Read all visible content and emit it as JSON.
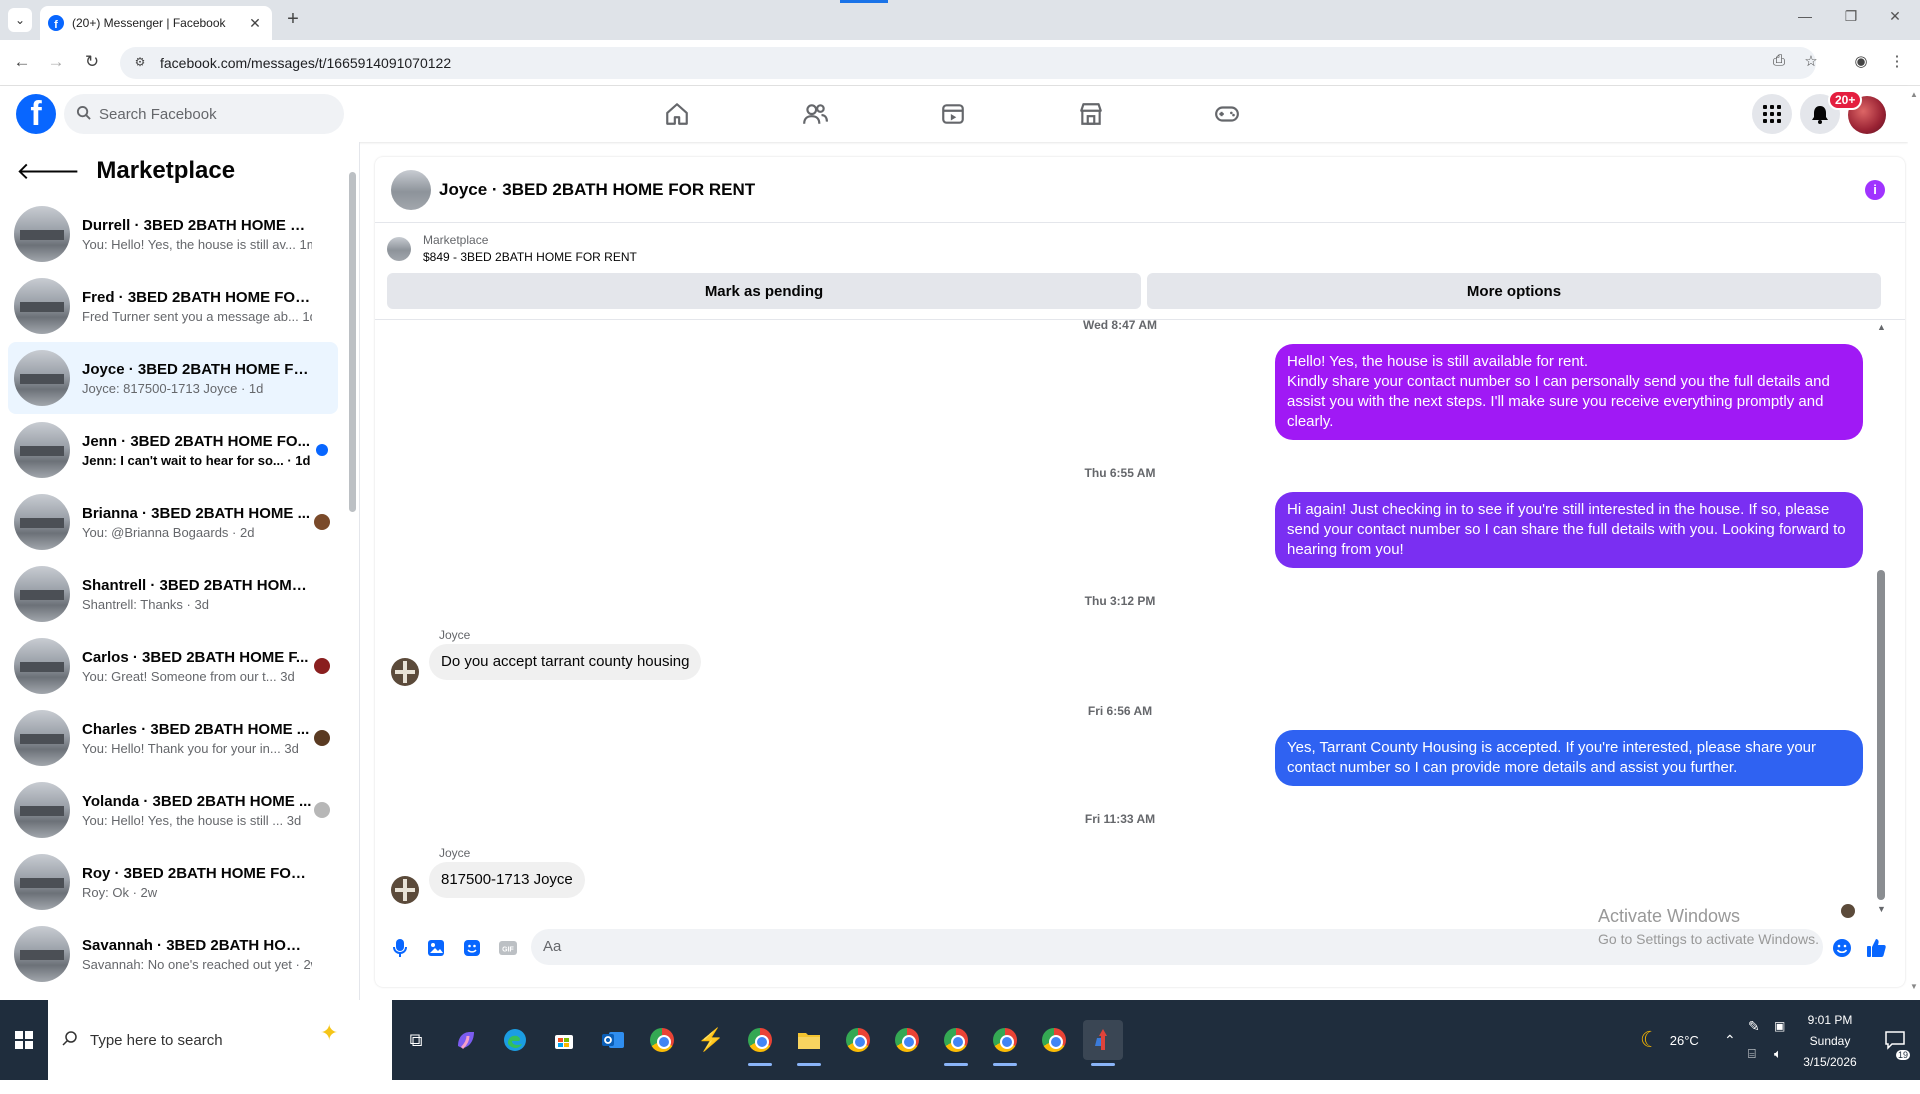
{
  "browser": {
    "tab_title": "(20+) Messenger | Facebook",
    "url": "facebook.com/messages/t/1665914091070122",
    "favicon_letter": "f"
  },
  "fb": {
    "search_placeholder": "Search Facebook",
    "logo_letter": "f",
    "notification_badge": "20+"
  },
  "sidebar": {
    "title": "Marketplace",
    "conversations": [
      {
        "name": "Durrell · 3BED 2BATH HOME FO...",
        "preview": "You: Hello! Yes, the house is still av... 1m",
        "unread": false
      },
      {
        "name": "Fred · 3BED 2BATH HOME FOR ...",
        "preview": "Fred Turner sent you a message ab... 1d",
        "unread": false
      },
      {
        "name": "Joyce · 3BED 2BATH HOME FOR ...",
        "preview": "Joyce: 817500-1713 Joyce · 1d",
        "unread": false,
        "active": true
      },
      {
        "name": "Jenn · 3BED 2BATH HOME FO...",
        "preview": "Jenn: I can't wait to hear for so... · 1d",
        "unread": true
      },
      {
        "name": "Brianna · 3BED 2BATH HOME ...",
        "preview": "You: @Brianna Bogaards · 2d",
        "unread": false
      },
      {
        "name": "Shantrell · 3BED 2BATH HOME F...",
        "preview": "Shantrell: Thanks · 3d",
        "unread": false
      },
      {
        "name": "Carlos · 3BED 2BATH HOME F...",
        "preview": "You: Great! Someone from our t... 3d",
        "unread": false
      },
      {
        "name": "Charles · 3BED 2BATH HOME ...",
        "preview": "You: Hello! Thank you for your in... 3d",
        "unread": false
      },
      {
        "name": "Yolanda · 3BED 2BATH HOME ...",
        "preview": "You: Hello! Yes, the house is still ... 3d",
        "unread": false
      },
      {
        "name": "Roy · 3BED 2BATH HOME FOR R...",
        "preview": "Roy: Ok · 2w",
        "unread": false
      },
      {
        "name": "Savannah · 3BED 2BATH HOME ...",
        "preview": "Savannah: No one's reached out yet · 2w",
        "unread": false
      }
    ]
  },
  "chat": {
    "title": "Joyce · 3BED 2BATH HOME FOR RENT",
    "listing_label": "Marketplace",
    "listing_detail": "$849 - 3BED 2BATH HOME FOR RENT",
    "mark_pending": "Mark as pending",
    "more_options": "More options",
    "timestamps": [
      "Wed 8:47 AM",
      "Thu 6:55 AM",
      "Thu 3:12 PM",
      "Fri 6:56 AM",
      "Fri 11:33 AM"
    ],
    "messages": {
      "out1": "Hello! Yes, the house is still available for rent.\nKindly share your contact number so I can personally send you the full details and assist you with the next steps. I'll make sure you receive everything promptly and clearly.",
      "out2": "Hi again! Just checking in to see if you're still interested in the house. If so, please send your contact number so I can share the full details with you. Looking forward to hearing from you!",
      "in1_sender": "Joyce",
      "in1": "Do you accept tarrant county housing",
      "out3": "Yes, Tarrant County Housing is accepted. If you're interested, please share your contact number so I can provide more details and assist you further.",
      "in2_sender": "Joyce",
      "in2": "817500-1713 Joyce"
    },
    "composer_placeholder": "Aa",
    "colors": {
      "bubble_1": "#a019f5",
      "bubble_2": "#7a2ff2",
      "bubble_3": "#2f62f2"
    }
  },
  "watermark": {
    "line1": "Activate Windows",
    "line2": "Go to Settings to activate Windows."
  },
  "taskbar": {
    "search_placeholder": "Type here to search",
    "weather": "26°C",
    "time": "9:01 PM",
    "day": "Sunday",
    "date": "3/15/2026",
    "notif_count": "19"
  }
}
